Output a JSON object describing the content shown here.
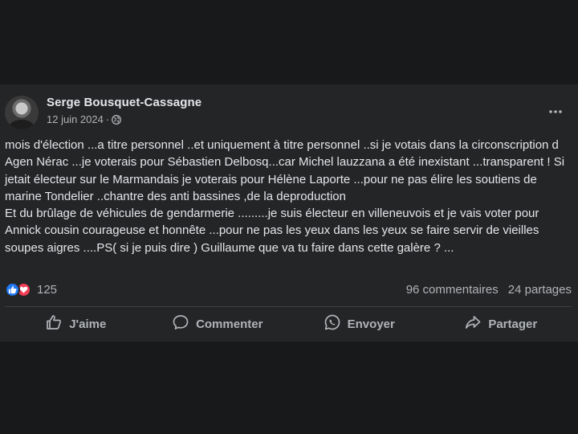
{
  "post": {
    "author": "Serge Bousquet-Cassagne",
    "date": "12 juin 2024",
    "separator": "·",
    "privacy_icon": "globe-icon",
    "more_icon": "more-options-icon",
    "body_lines": [
      "mois d'élection ...a titre personnel ..et uniquement à titre personnel ..si je votais dans la circonscription d Agen Nérac ...je voterais pour Sébastien Delbosq...car Michel lauzzana a été inexistant ...transparent ! Si jetait électeur sur le Marmandais je voterais pour Hélène Laporte ...pour ne pas élire les soutiens de marine Tondelier ..chantre des anti bassines ,de la deproduction",
      "Et du brûlage de véhicules de gendarmerie .........je suis électeur en villeneuvois et je vais voter pour Annick cousin courageuse et honnête ...pour ne pas les yeux dans les yeux se faire servir de vieilles soupes aigres ....PS( si je puis dire ) Guillaume que va tu faire dans cette galère ? ..."
    ]
  },
  "stats": {
    "reaction_count": "125",
    "reactions": [
      "like-icon",
      "love-icon"
    ],
    "comments": "96 commentaires",
    "shares": "24 partages"
  },
  "actions": {
    "like": "J'aime",
    "comment": "Commenter",
    "send": "Envoyer",
    "share": "Partager"
  },
  "colors": {
    "background": "#18191a",
    "card": "#242526",
    "text": "#e4e6eb",
    "secondary": "#b0b3b8",
    "like": "#2078f4",
    "love": "#f33e58"
  }
}
